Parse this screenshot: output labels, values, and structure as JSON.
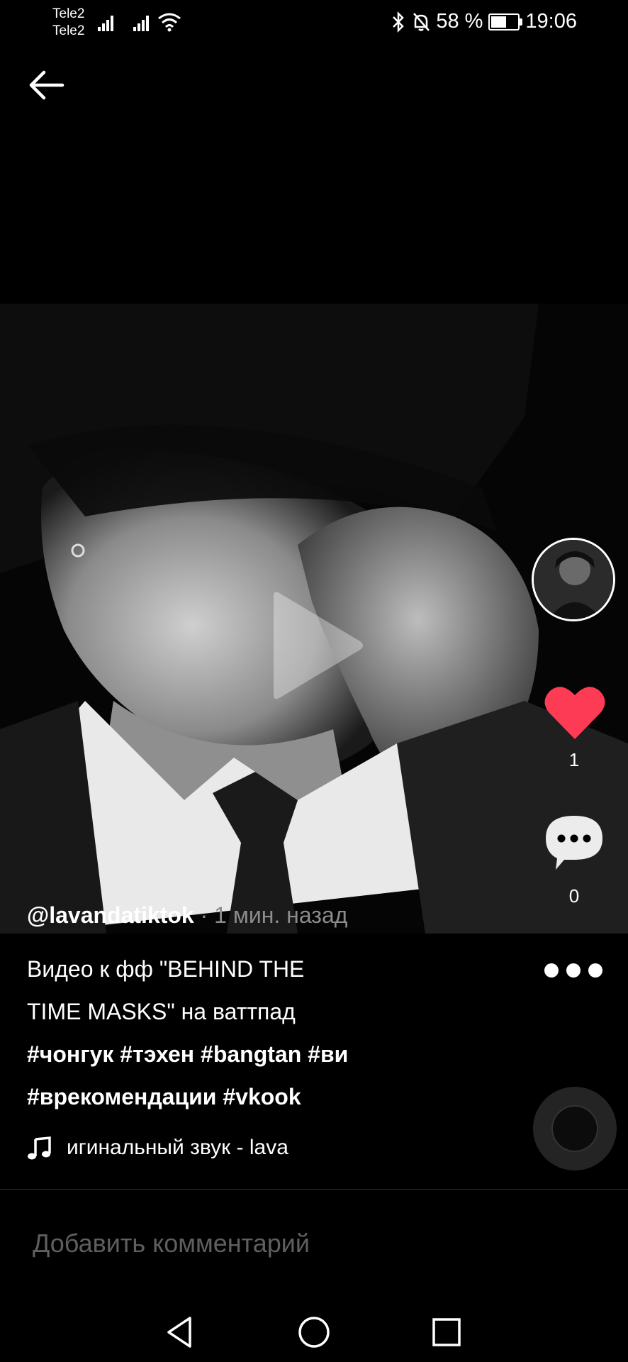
{
  "status_bar": {
    "carrier1": "Tele2",
    "carrier2": "Tele2",
    "battery_percent": "58 %",
    "battery_level": 0.58,
    "time": "19:06"
  },
  "video": {
    "author": "@lavandatiktok",
    "time_ago": "· 1 мин. назад"
  },
  "actions": {
    "likes": "1",
    "comments": "0"
  },
  "description": {
    "text_line1": "Видео к фф \"BEHIND THE",
    "text_line2": "TIME MASKS\" на ваттпад",
    "tags_line1": "#чонгук #тэхен #bangtan #ви",
    "tags_line2": "#врекомендации #vkook"
  },
  "sound": {
    "text": "игинальный звук - lava"
  },
  "comment_input": {
    "placeholder": "Добавить комментарий"
  },
  "icons": [
    "back-arrow-icon",
    "bluetooth-icon",
    "mute-bell-icon",
    "battery-icon",
    "play-icon",
    "heart-icon",
    "comment-icon",
    "more-icon",
    "music-note-icon",
    "nav-back-icon",
    "nav-home-icon",
    "nav-recent-icon"
  ],
  "colors": {
    "like": "#fd3b55",
    "background": "#000000"
  }
}
